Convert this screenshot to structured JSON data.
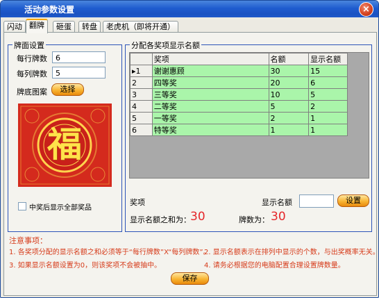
{
  "window": {
    "title": "活动参数设置",
    "close": "×"
  },
  "tabs": [
    "闪动",
    "翻牌",
    "砸蛋",
    "转盘",
    "老虎机（即将开通）"
  ],
  "card_face": {
    "group_title": "牌面设置",
    "rows_label": "每行牌数",
    "rows_value": "6",
    "cols_label": "每列牌数",
    "cols_value": "5",
    "back_label": "牌底图案",
    "select_button": "选择",
    "image_text": "福",
    "show_all_label": "中奖后显示全部奖品"
  },
  "prizes": {
    "group_title": "分配各奖项显示名额",
    "columns": [
      "奖项",
      "名额",
      "显示名额"
    ],
    "rows": [
      {
        "idx": "1",
        "name": "谢谢惠顾",
        "quota": "30",
        "display": "15"
      },
      {
        "idx": "2",
        "name": "四等奖",
        "quota": "20",
        "display": "6"
      },
      {
        "idx": "3",
        "name": "三等奖",
        "quota": "10",
        "display": "5"
      },
      {
        "idx": "4",
        "name": "二等奖",
        "quota": "5",
        "display": "2"
      },
      {
        "idx": "5",
        "name": "一等奖",
        "quota": "2",
        "display": "1"
      },
      {
        "idx": "6",
        "name": "特等奖",
        "quota": "1",
        "display": "1"
      }
    ],
    "prize_label": "奖项",
    "display_count_label": "显示名额",
    "display_count_value": "",
    "set_button": "设置",
    "sum_label": "显示名额之和为：",
    "sum_value": "30",
    "cards_label": "牌数为：",
    "cards_value": "30"
  },
  "notes": {
    "title": "注意事项：",
    "n1": "1. 各奖项分配的显示名额之和必须等于“每行牌数”X“每列牌数”。",
    "n2": "2. 显示名额表示在排列中显示的个数，与出奖概率无关。",
    "n3": "3. 如果显示名额设置为0，则该奖项不会被抽中。",
    "n4": "4. 请务必根据您的电脑配置合理设置牌数量。"
  },
  "save_button": "保存"
}
